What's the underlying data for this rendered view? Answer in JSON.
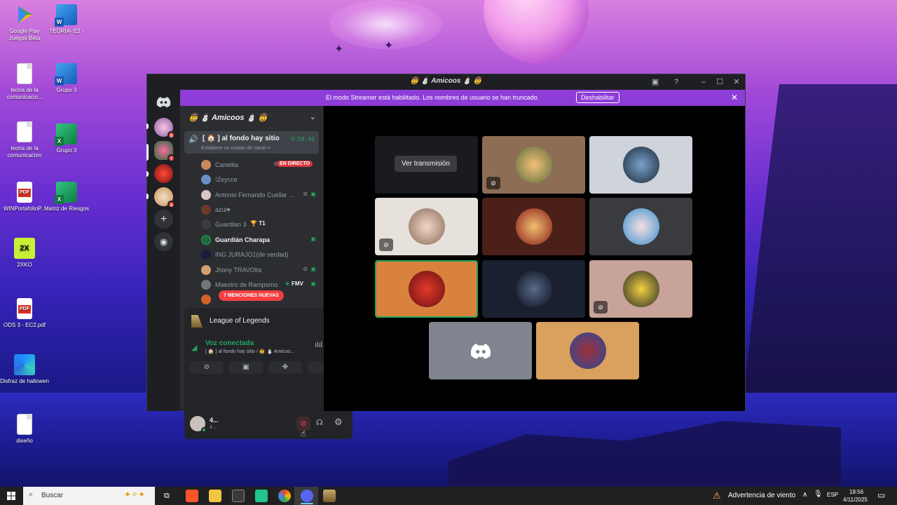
{
  "desktop": {
    "icons": [
      {
        "label": "Google Play Juegos Beta"
      },
      {
        "label": "TEORIA- E2 -"
      },
      {
        "label": "teoria de la comunicacio..."
      },
      {
        "label": "Grupo 3"
      },
      {
        "label": "teoria de la comunicacion"
      },
      {
        "label": "Grupo 3"
      },
      {
        "label": "WINPortafolioP..."
      },
      {
        "label": "Matriz de Riesgos"
      },
      {
        "label": "2XKO"
      },
      {
        "label": "ODS 3 - EC2.pdf"
      },
      {
        "label": "Disfraz de hallowen"
      },
      {
        "label": "diseño"
      }
    ]
  },
  "window": {
    "title": "🤠 ⛄ Amicoos ⛄ 🤠",
    "streamer_banner": {
      "message": "El modo Streamer está habilitado. Los nombres de usuario se han truncado.",
      "disable_button": "Deshabilitar"
    }
  },
  "server_rail": {
    "badges": [
      "8",
      "7",
      "4"
    ]
  },
  "channel_panel": {
    "guild_name": "🤠 ⛄ Amicoos ⛄ 🤠",
    "voice_channel": {
      "name": "[ 🏠 ] al fondo hay sitio",
      "timer": "9:59:46",
      "status_hint": "Establece un estado de canal ✏"
    },
    "members": [
      {
        "name": "Canelita",
        "badge": "EN DIRECTO"
      },
      {
        "name": "!Zeycce"
      },
      {
        "name": "Antonio Fernando Cuellar ..."
      },
      {
        "name": "azul♥"
      },
      {
        "name": "Guardian 3",
        "tag": "T1"
      },
      {
        "name": "Guardián Charapa"
      },
      {
        "name": "ING JURAJO1(de verdad)"
      },
      {
        "name": "Jhony TRAVOlta"
      },
      {
        "name": "Maestro de Ramporno",
        "tag": "FMV"
      }
    ],
    "mentions_pill": "7 MENCIONES NUEVAS"
  },
  "activity": {
    "game": "League of Legends"
  },
  "voice_panel": {
    "status": "Voz conectada",
    "location": "[ 🏠 ] al fondo hay sitio / 🤠 ⛄ Amicoo..."
  },
  "user_panel": {
    "name": "4...",
    "sub": "4..."
  },
  "stage": {
    "watch_stream_label": "Ver transmisión"
  },
  "taskbar": {
    "search_placeholder": "Buscar",
    "weather": "Advertencia de viento",
    "language": "ESP",
    "time": "18:56",
    "date": "4/11/2025"
  },
  "colors": {
    "discord_dark": "#1e1f22",
    "channel_bg": "#2b2d31",
    "streamer_banner": "#8e3dd8",
    "voice_green": "#23a55a",
    "live_red": "#da373c"
  }
}
